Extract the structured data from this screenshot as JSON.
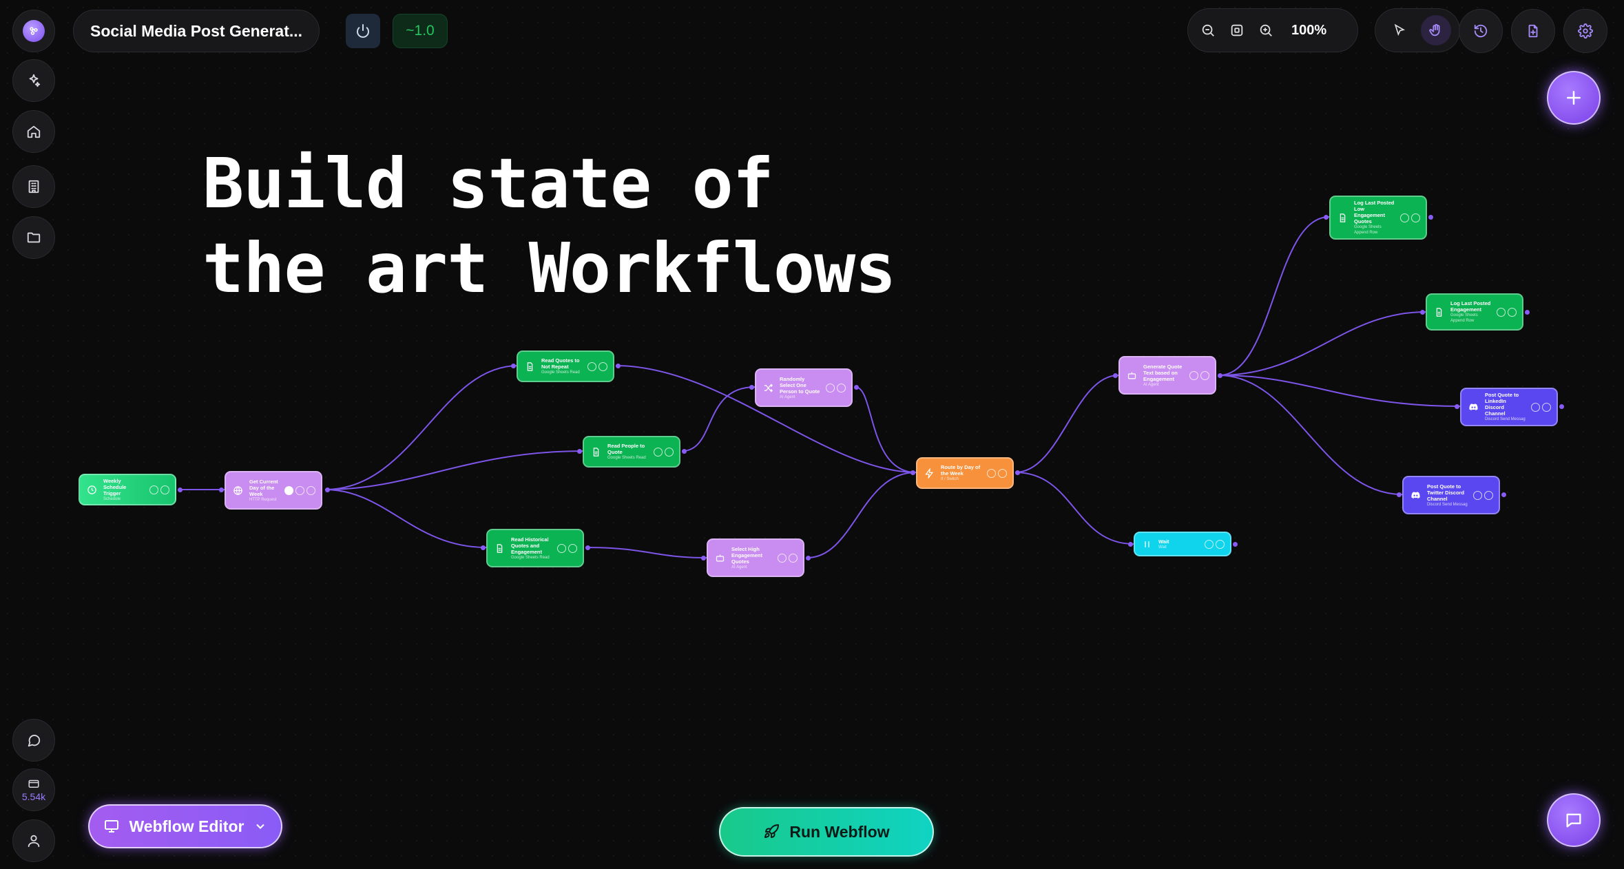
{
  "header": {
    "workflow_name": "Social Media Post Generat...",
    "version": "~1.0",
    "zoom": "100%"
  },
  "hero": {
    "line1": "Build state of",
    "line2": "the art Workflows"
  },
  "sidebar": {
    "credits": "5.54k"
  },
  "nodes": {
    "weekly": {
      "title": "Weekly Schedule Trigger",
      "sub": "Schedule"
    },
    "current_day": {
      "title": "Get Current Day of the Week",
      "sub": "HTTP Request"
    },
    "quotes_not_repeat": {
      "title": "Read Quotes to Not Repeat",
      "sub": "Google Sheets Read"
    },
    "people_quote": {
      "title": "Read People to Quote",
      "sub": "Google Sheets Read"
    },
    "historical": {
      "title": "Read Historical Quotes and Engagement",
      "sub": "Google Sheets Read"
    },
    "random_person": {
      "title": "Randomly Select One Person to Quote",
      "sub": "AI Agent"
    },
    "high_engagement": {
      "title": "Select High Engagement Quotes",
      "sub": "AI Agent"
    },
    "route_day": {
      "title": "Route by Day of the Week",
      "sub": "If / Switch"
    },
    "generate_quote": {
      "title": "Generate Quote Text based on Engagement",
      "sub": "AI Agent"
    },
    "log_low": {
      "title": "Log Last Posted Low Engagement Quotes",
      "sub": "Google Sheets Append Row"
    },
    "log_engagement": {
      "title": "Log Last Posted Engagement",
      "sub": "Google Sheets Append Row"
    },
    "post_linkedin": {
      "title": "Post Quote to LinkedIn Discord Channel",
      "sub": "Discord Send Message"
    },
    "post_twitter": {
      "title": "Post Quote to Twitter Discord Channel",
      "sub": "Discord Send Message"
    },
    "wait": {
      "title": "Wait",
      "sub": "Wait"
    }
  },
  "bottom": {
    "editor_label": "Webflow Editor",
    "run_label": "Run Webflow"
  },
  "colors": {
    "accent": "#8b5cf6",
    "run_start": "#19c98a",
    "run_end": "#0fd3c2",
    "edge": "#7d55e8"
  },
  "icons": [
    "logo-icon",
    "sparkles-icon",
    "home-icon",
    "building-icon",
    "folder-icon",
    "message-icon",
    "credits-icon",
    "user-icon",
    "chevron-down-icon",
    "power-icon",
    "zoom-out-icon",
    "fit-icon",
    "zoom-in-icon",
    "pointer-icon",
    "hand-icon",
    "history-icon",
    "file-plus-icon",
    "gear-icon",
    "plus-icon",
    "monitor-icon",
    "rocket-icon",
    "chat-icon"
  ]
}
